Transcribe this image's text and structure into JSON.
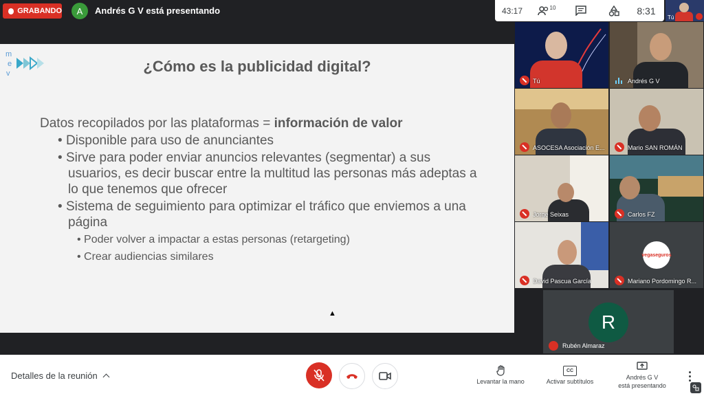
{
  "header": {
    "recording_label": "GRABANDO",
    "presenter_initial": "A",
    "presenter_text": "Andrés G V está presentando",
    "elapsed": "43:17",
    "participants_count": "10",
    "clock": "8:31",
    "self_label": "Tú"
  },
  "slide": {
    "title": "¿Cómo es la publicidad digital?",
    "lead_text": "Datos recopilados por las plataformas = ",
    "lead_bold": "información de valor",
    "bullets": [
      "Disponible para uso de anunciantes",
      "Sirve para poder enviar anuncios relevantes (segmentar) a sus usuarios, es decir buscar entre la multitud las personas más adeptas a lo que tenemos que ofrecer",
      "Sistema de seguimiento para optimizar el tráfico que enviemos a una página"
    ],
    "sub_bullets": [
      "Poder volver a impactar a estas personas (retargeting)",
      "Crear audiencias similares"
    ],
    "logo_letters": [
      "m",
      "e",
      "v"
    ]
  },
  "participants": [
    {
      "name": "Tú"
    },
    {
      "name": "Andrés G V"
    },
    {
      "name": "ASOCESA Asociación E..."
    },
    {
      "name": "Mario SAN ROMÁN"
    },
    {
      "name": "Jorge Seixas"
    },
    {
      "name": "Carlos FZ"
    },
    {
      "name": "David Pascua García"
    },
    {
      "name": "Mariano Pordomingo R..."
    },
    {
      "name": "Rubén Almaraz",
      "initial": "R"
    }
  ],
  "vegaseguros_logo_text": "vegaseguros",
  "controls": {
    "details_label": "Detalles de la reunión",
    "raise_hand_label": "Levantar la mano",
    "captions_label": "Activar subtítulos",
    "captions_icon_text": "CC",
    "presenting_label_line1": "Andrés G V",
    "presenting_label_line2": "está presentando"
  },
  "colors": {
    "red": "#d93025",
    "dark_bg": "#202124",
    "slide_bg": "#f3f3f3",
    "slide_text": "#595959",
    "avatar_green": "#0f5a43"
  }
}
